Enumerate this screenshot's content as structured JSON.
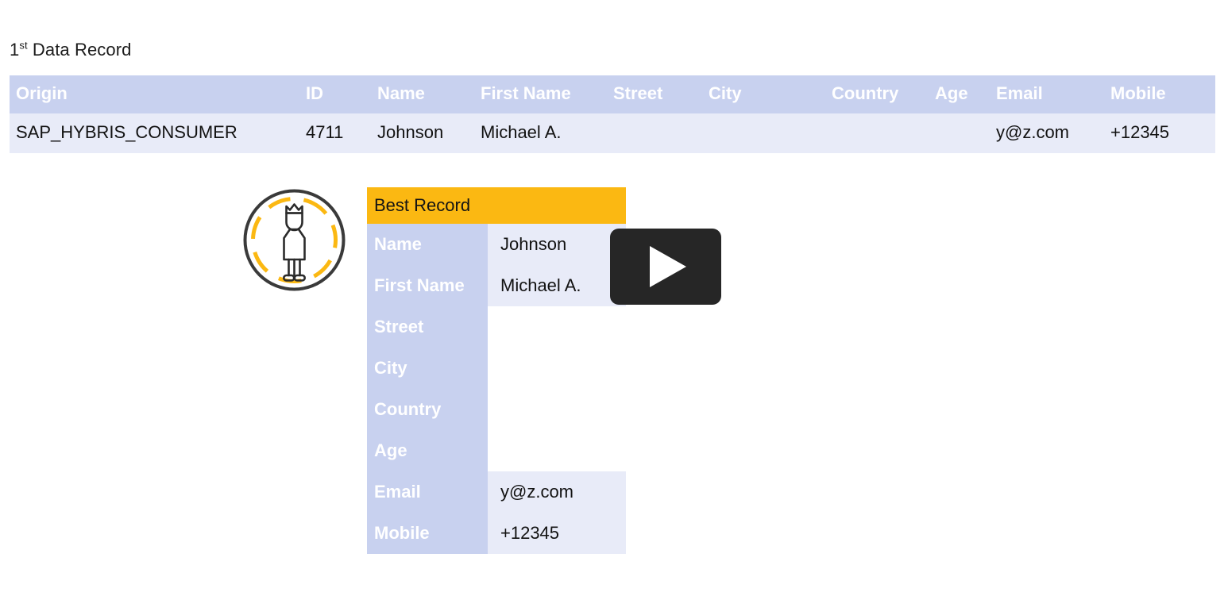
{
  "page": {
    "title_prefix": "1",
    "title_sup": "st",
    "title_rest": " Data Record"
  },
  "colors": {
    "header_blue": "#c8d1ef",
    "row_lavender": "#e8ebf8",
    "accent_gold": "#fbb812",
    "play_dark": "#262626",
    "text_dark": "#121212",
    "avatar_ring": "#3a3a3a"
  },
  "record_table": {
    "columns": [
      {
        "key": "origin",
        "label": "Origin"
      },
      {
        "key": "id",
        "label": "ID"
      },
      {
        "key": "name",
        "label": "Name"
      },
      {
        "key": "first",
        "label": "First Name"
      },
      {
        "key": "street",
        "label": "Street"
      },
      {
        "key": "city",
        "label": "City"
      },
      {
        "key": "country",
        "label": "Country"
      },
      {
        "key": "age",
        "label": "Age"
      },
      {
        "key": "email",
        "label": "Email"
      },
      {
        "key": "mobile",
        "label": "Mobile"
      }
    ],
    "rows": [
      {
        "origin": "SAP_HYBRIS_CONSUMER",
        "id": "4711",
        "name": "Johnson",
        "first": "Michael A.",
        "street": "",
        "city": "",
        "country": "",
        "age": "",
        "email": "y@z.com",
        "mobile": "+12345"
      }
    ]
  },
  "best_record": {
    "header_label": "Best Record",
    "fields": [
      {
        "label": "Name",
        "value": "Johnson"
      },
      {
        "label": "First Name",
        "value": "Michael A."
      },
      {
        "label": "Street",
        "value": ""
      },
      {
        "label": "City",
        "value": ""
      },
      {
        "label": "Country",
        "value": ""
      },
      {
        "label": "Age",
        "value": ""
      },
      {
        "label": "Email",
        "value": "y@z.com"
      },
      {
        "label": "Mobile",
        "value": "+12345"
      }
    ]
  },
  "avatar": {
    "icon": "crowned-person-icon"
  },
  "play_button": {
    "icon": "play-icon"
  }
}
